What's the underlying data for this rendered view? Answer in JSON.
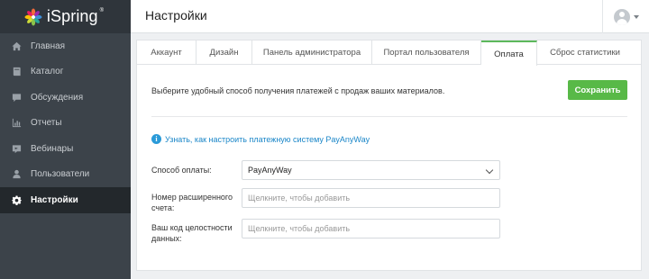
{
  "app": {
    "logo_text": "iSpring",
    "logo_mark": "®"
  },
  "sidebar": {
    "items": [
      {
        "label": "Главная",
        "icon": "home-icon"
      },
      {
        "label": "Каталог",
        "icon": "book-icon"
      },
      {
        "label": "Обсуждения",
        "icon": "chat-icon"
      },
      {
        "label": "Отчеты",
        "icon": "bar-chart-icon"
      },
      {
        "label": "Вебинары",
        "icon": "webinar-icon"
      },
      {
        "label": "Пользователи",
        "icon": "user-icon"
      },
      {
        "label": "Настройки",
        "icon": "gear-icon",
        "active": true
      }
    ]
  },
  "header": {
    "title": "Настройки"
  },
  "tabs": [
    {
      "label": "Аккаунт"
    },
    {
      "label": "Дизайн"
    },
    {
      "label": "Панель администратора"
    },
    {
      "label": "Портал пользователя"
    },
    {
      "label": "Оплата",
      "active": true
    },
    {
      "label": "Сброс статистики"
    }
  ],
  "payment": {
    "description": "Выберите удобный способ получения платежей с продаж ваших материалов.",
    "save_label": "Сохранить",
    "help_link": "Узнать, как настроить платежную систему PayAnyWay",
    "method_label": "Способ оплаты:",
    "method_value": "PayAnyWay",
    "account_label": "Номер расширенного счета:",
    "account_placeholder": "Щелкните, чтобы добавить",
    "integrity_label": "Ваш код целостности данных:",
    "integrity_placeholder": "Щелкните, чтобы добавить"
  },
  "colors": {
    "sidebar": "#3c434a",
    "accent_green": "#58b947",
    "link_blue": "#1a86c8"
  }
}
